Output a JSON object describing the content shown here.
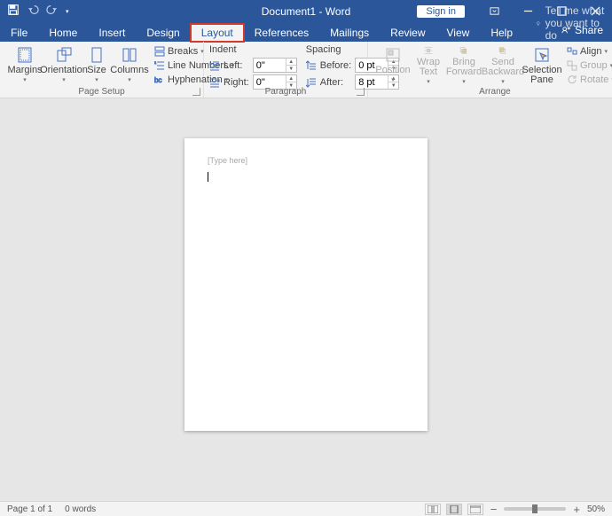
{
  "titlebar": {
    "doc_title": "Document1 - Word",
    "signin": "Sign in"
  },
  "tabs": {
    "file": "File",
    "home": "Home",
    "insert": "Insert",
    "design": "Design",
    "layout": "Layout",
    "references": "References",
    "mailings": "Mailings",
    "review": "Review",
    "view": "View",
    "help": "Help",
    "tellme_placeholder": "Tell me what you want to do",
    "share": "Share"
  },
  "ribbon": {
    "page_setup": {
      "label": "Page Setup",
      "margins": "Margins",
      "orientation": "Orientation",
      "size": "Size",
      "columns": "Columns",
      "breaks": "Breaks",
      "line_numbers": "Line Numbers",
      "hyphenation": "Hyphenation"
    },
    "paragraph": {
      "label": "Paragraph",
      "indent_head": "Indent",
      "spacing_head": "Spacing",
      "left_label": "Left:",
      "right_label": "Right:",
      "before_label": "Before:",
      "after_label": "After:",
      "left_val": "0\"",
      "right_val": "0\"",
      "before_val": "0 pt",
      "after_val": "8 pt"
    },
    "arrange": {
      "label": "Arrange",
      "position": "Position",
      "wrap_text": "Wrap Text",
      "bring_forward": "Bring Forward",
      "send_backward": "Send Backward",
      "selection_pane": "Selection Pane",
      "align": "Align",
      "group": "Group",
      "rotate": "Rotate"
    }
  },
  "document": {
    "placeholder": "[Type here]"
  },
  "statusbar": {
    "page_info": "Page 1 of 1",
    "word_count": "0 words",
    "zoom_pct": "50%"
  }
}
